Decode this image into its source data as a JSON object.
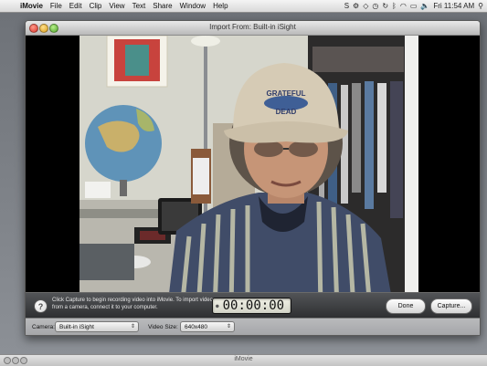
{
  "menubar": {
    "app": "iMovie",
    "items": [
      "File",
      "Edit",
      "Clip",
      "View",
      "Text",
      "Share",
      "Window",
      "Help"
    ],
    "clock": "Fri 11:54 AM"
  },
  "window": {
    "title": "Import From: Built-in iSight"
  },
  "controls": {
    "help_symbol": "?",
    "message": "Click Capture to begin recording video into iMovie. To import video from a camera, connect it to your computer.",
    "timecode": "00:00:00",
    "done_label": "Done",
    "capture_label": "Capture..."
  },
  "settings": {
    "camera_label": "Camera:",
    "camera_value": "Built-in iSight",
    "size_label": "Video Size:",
    "size_value": "640x480"
  },
  "second_window": {
    "title": "iMovie"
  },
  "cap_text": {
    "line1": "GRATEFUL",
    "line2": "DEAD"
  }
}
